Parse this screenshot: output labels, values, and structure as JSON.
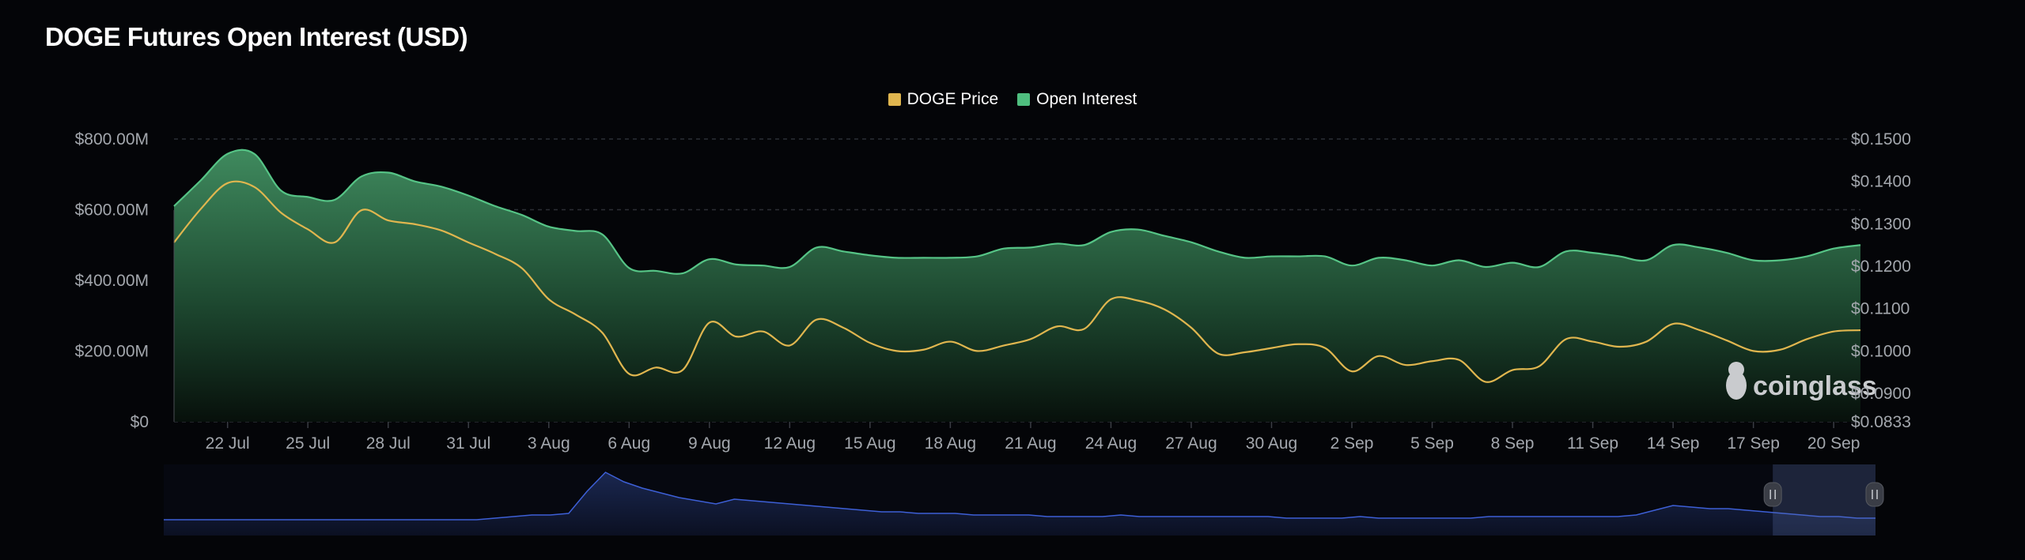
{
  "title": "DOGE Futures Open Interest (USD)",
  "legend": [
    {
      "label": "DOGE Price",
      "color": "#e0b64f"
    },
    {
      "label": "Open Interest",
      "color": "#4fbf7f"
    }
  ],
  "watermark": "coinglass",
  "chart_data": {
    "type": "area",
    "title": "DOGE Futures Open Interest (USD)",
    "x": [
      "20 Jul",
      "21 Jul",
      "22 Jul",
      "23 Jul",
      "24 Jul",
      "25 Jul",
      "26 Jul",
      "27 Jul",
      "28 Jul",
      "29 Jul",
      "30 Jul",
      "31 Jul",
      "1 Aug",
      "2 Aug",
      "3 Aug",
      "4 Aug",
      "5 Aug",
      "6 Aug",
      "7 Aug",
      "8 Aug",
      "9 Aug",
      "10 Aug",
      "11 Aug",
      "12 Aug",
      "13 Aug",
      "14 Aug",
      "15 Aug",
      "16 Aug",
      "17 Aug",
      "18 Aug",
      "19 Aug",
      "20 Aug",
      "21 Aug",
      "22 Aug",
      "23 Aug",
      "24 Aug",
      "25 Aug",
      "26 Aug",
      "27 Aug",
      "28 Aug",
      "29 Aug",
      "30 Aug",
      "31 Aug",
      "1 Sep",
      "2 Sep",
      "3 Sep",
      "4 Sep",
      "5 Sep",
      "6 Sep",
      "7 Sep",
      "8 Sep",
      "9 Sep",
      "10 Sep",
      "11 Sep",
      "12 Sep",
      "13 Sep",
      "14 Sep",
      "15 Sep",
      "16 Sep",
      "17 Sep",
      "18 Sep",
      "19 Sep",
      "20 Sep",
      "21 Sep"
    ],
    "series": [
      {
        "name": "Open Interest",
        "axis": "left",
        "type": "area",
        "values": [
          610,
          683,
          758,
          758,
          654,
          636,
          628,
          694,
          705,
          680,
          665,
          640,
          610,
          585,
          552,
          540,
          530,
          435,
          427,
          420,
          460,
          445,
          442,
          438,
          493,
          482,
          471,
          464,
          464,
          464,
          468,
          490,
          493,
          504,
          500,
          537,
          544,
          526,
          508,
          482,
          464,
          468,
          468,
          468,
          442,
          464,
          457,
          442,
          457,
          438,
          450,
          438,
          482,
          478,
          468,
          457,
          500,
          493,
          478,
          457,
          457,
          468,
          490,
          500
        ]
      },
      {
        "name": "DOGE Price",
        "axis": "right",
        "type": "line",
        "values": [
          0.1256,
          0.1335,
          0.1396,
          0.1387,
          0.1326,
          0.1287,
          0.1256,
          0.1332,
          0.1308,
          0.1299,
          0.1284,
          0.1256,
          0.1229,
          0.1195,
          0.1122,
          0.1086,
          0.1043,
          0.0946,
          0.0961,
          0.0955,
          0.1067,
          0.1034,
          0.1046,
          0.1013,
          0.1074,
          0.1055,
          0.1019,
          0.1,
          0.1003,
          0.1022,
          0.1,
          0.1013,
          0.1028,
          0.1058,
          0.1052,
          0.1122,
          0.1119,
          0.1098,
          0.1055,
          0.0994,
          0.0997,
          0.1007,
          0.1016,
          0.1007,
          0.0952,
          0.0988,
          0.0967,
          0.0976,
          0.0979,
          0.0927,
          0.0955,
          0.0964,
          0.1028,
          0.1022,
          0.101,
          0.1022,
          0.1064,
          0.1049,
          0.1025,
          0.1,
          0.1003,
          0.1028,
          0.1046,
          0.1049
        ]
      }
    ],
    "y_left": {
      "ticks": [
        "$0",
        "$200.00M",
        "$400.00M",
        "$600.00M",
        "$800.00M"
      ],
      "values": [
        0,
        200,
        400,
        600,
        800
      ],
      "range": [
        0,
        800
      ]
    },
    "y_right": {
      "ticks": [
        "$0.0833",
        "$0.0900",
        "$0.1000",
        "$0.1100",
        "$0.1200",
        "$0.1300",
        "$0.1400",
        "$0.1500"
      ],
      "values": [
        0.0833,
        0.09,
        0.1,
        0.11,
        0.12,
        0.13,
        0.14,
        0.15
      ],
      "range": [
        0.0833,
        0.15
      ]
    },
    "x_ticks": [
      "22 Jul",
      "25 Jul",
      "28 Jul",
      "31 Jul",
      "3 Aug",
      "6 Aug",
      "9 Aug",
      "12 Aug",
      "15 Aug",
      "18 Aug",
      "21 Aug",
      "24 Aug",
      "27 Aug",
      "30 Aug",
      "2 Sep",
      "5 Sep",
      "8 Sep",
      "11 Sep",
      "14 Sep",
      "17 Sep",
      "20 Sep"
    ],
    "grid": true,
    "legend_position": "top-center",
    "navigator": {
      "values": [
        10,
        10,
        10,
        10,
        10,
        10,
        10,
        10,
        10,
        10,
        10,
        10,
        10,
        10,
        10,
        10,
        10,
        10,
        11,
        12,
        13,
        13,
        14,
        28,
        40,
        34,
        30,
        27,
        24,
        22,
        20,
        23,
        22,
        21,
        20,
        19,
        18,
        17,
        16,
        15,
        15,
        14,
        14,
        14,
        13,
        13,
        13,
        13,
        12,
        12,
        12,
        12,
        13,
        12,
        12,
        12,
        12,
        12,
        12,
        12,
        12,
        11,
        11,
        11,
        11,
        12,
        11,
        11,
        11,
        11,
        11,
        11,
        12,
        12,
        12,
        12,
        12,
        12,
        12,
        12,
        13,
        16,
        19,
        18,
        17,
        17,
        16,
        15,
        14,
        13,
        12,
        12,
        11,
        11
      ],
      "selected_range": [
        0.94,
        1.0
      ]
    }
  }
}
